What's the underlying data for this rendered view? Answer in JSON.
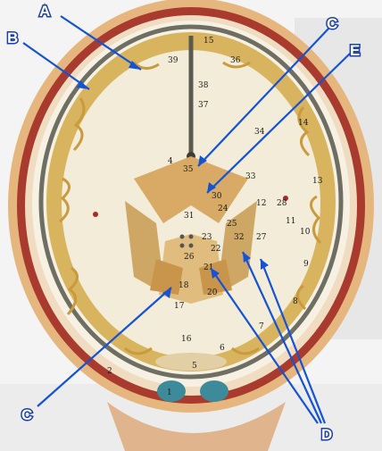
{
  "figure": {
    "callout_labels": {
      "a": "A",
      "b": "B",
      "c_top": "C",
      "e": "E",
      "c_bottom": "C",
      "d": "D"
    },
    "model_numbers": [
      "15",
      "39",
      "36",
      "38",
      "37",
      "35",
      "4",
      "34",
      "33",
      "14",
      "30",
      "12",
      "28",
      "13",
      "11",
      "10",
      "24",
      "31",
      "25",
      "22",
      "27",
      "23",
      "32",
      "26",
      "21",
      "9",
      "18",
      "20",
      "8",
      "17",
      "7",
      "16",
      "6",
      "5",
      "2",
      "1"
    ],
    "colors": {
      "arrow": "#1552d6",
      "white_matter": "#f3ecd9",
      "gray_matter": "#d8b45e",
      "skull_outline": "#6e6e62",
      "scalp": "#e6b67f",
      "muscle": "#a83a2e"
    }
  }
}
